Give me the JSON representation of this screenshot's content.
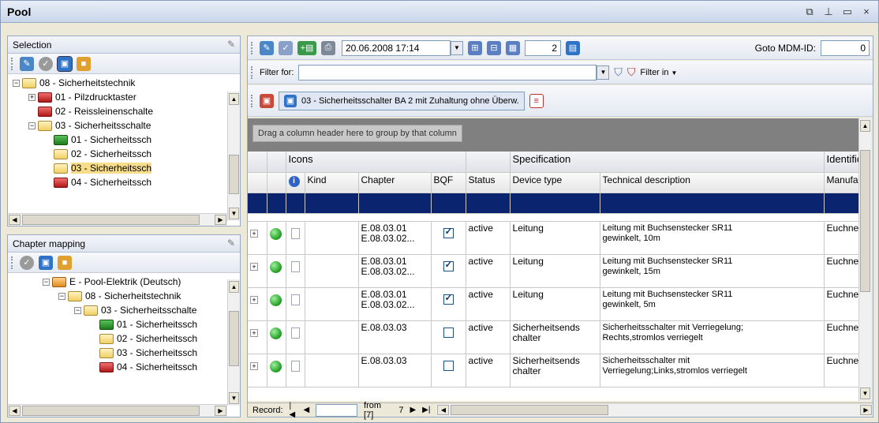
{
  "window": {
    "title": "Pool"
  },
  "title_buttons": [
    "⧉",
    "⊥",
    "▭",
    "×"
  ],
  "selection_panel": {
    "title": "Selection",
    "tree": [
      {
        "label": "08 - Sicherheitstechnik",
        "level": 0,
        "expander": "−",
        "folder": "yellow"
      },
      {
        "label": "01 - Pilzdrucktaster",
        "level": 1,
        "expander": "+",
        "folder": "red"
      },
      {
        "label": "02 - Reissleinenschalte",
        "level": 1,
        "expander": "",
        "folder": "red"
      },
      {
        "label": "03 - Sicherheitsschalte",
        "level": 1,
        "expander": "−",
        "folder": "yellow"
      },
      {
        "label": "01 - Sicherheitssch",
        "level": 2,
        "expander": "",
        "folder": "green"
      },
      {
        "label": "02 - Sicherheitssch",
        "level": 2,
        "expander": "",
        "folder": "yellow"
      },
      {
        "label": "03 - Sicherheitssch",
        "level": 2,
        "expander": "",
        "folder": "yellow",
        "selected": true
      },
      {
        "label": "04 - Sicherheitssch",
        "level": 2,
        "expander": "",
        "folder": "red"
      }
    ]
  },
  "chapter_panel": {
    "title": "Chapter mapping",
    "tree": [
      {
        "label": "E - Pool-Elektrik (Deutsch)",
        "level": 0,
        "expander": "−",
        "folder": "orange"
      },
      {
        "label": "08 - Sicherheitstechnik",
        "level": 1,
        "expander": "−",
        "folder": "yellow"
      },
      {
        "label": "03 - Sicherheitsschalte",
        "level": 2,
        "expander": "−",
        "folder": "yellow"
      },
      {
        "label": "01 - Sicherheitssch",
        "level": 3,
        "expander": "",
        "folder": "green"
      },
      {
        "label": "02 - Sicherheitssch",
        "level": 3,
        "expander": "",
        "folder": "yellow"
      },
      {
        "label": "03 - Sicherheitssch",
        "level": 3,
        "expander": "",
        "folder": "yellow"
      },
      {
        "label": "04 - Sicherheitssch",
        "level": 3,
        "expander": "",
        "folder": "red"
      }
    ]
  },
  "toolbar": {
    "datetime": "20.06.2008 17:14",
    "page_value": "2",
    "goto_label": "Goto MDM-ID:",
    "goto_value": "0"
  },
  "filter": {
    "label": "Filter for:",
    "value": "",
    "filter_in_label": "Filter in"
  },
  "breadcrumb": {
    "label": "03 - Sicherheitsschalter BA 2 mit Zuhaltung ohne Überw."
  },
  "grid": {
    "group_hint": "Drag a column header here to group by that column",
    "bands": [
      "Icons",
      "Specification",
      "Identificatio"
    ],
    "columns": [
      "",
      "Kind",
      "Chapter",
      "BQF",
      "Status",
      "Device type",
      "Technical description",
      "Manufacturer"
    ],
    "rows": [
      {
        "chapter_l1": "E.08.03.01",
        "chapter_l2": "E.08.03.02...",
        "bqf": true,
        "status": "active",
        "device_l1": "Leitung",
        "device_l2": "",
        "desc_l1": "Leitung mit Buchsenstecker SR11",
        "desc_l2": "gewinkelt, 10m",
        "manufacturer": "Euchner"
      },
      {
        "chapter_l1": "E.08.03.01",
        "chapter_l2": "E.08.03.02...",
        "bqf": true,
        "status": "active",
        "device_l1": "Leitung",
        "device_l2": "",
        "desc_l1": "Leitung mit Buchsenstecker SR11",
        "desc_l2": "gewinkelt, 15m",
        "manufacturer": "Euchner"
      },
      {
        "chapter_l1": "E.08.03.01",
        "chapter_l2": "E.08.03.02...",
        "bqf": true,
        "status": "active",
        "device_l1": "Leitung",
        "device_l2": "",
        "desc_l1": "Leitung mit Buchsenstecker SR11",
        "desc_l2": "gewinkelt, 5m",
        "manufacturer": "Euchner"
      },
      {
        "chapter_l1": "E.08.03.03",
        "chapter_l2": "",
        "bqf": false,
        "status": "active",
        "device_l1": "Sicherheitsends",
        "device_l2": "chalter",
        "desc_l1": "Sicherheitsschalter mit Verriegelung;",
        "desc_l2": "Rechts,stromlos verriegelt",
        "manufacturer": "Euchner"
      },
      {
        "chapter_l1": "E.08.03.03",
        "chapter_l2": "",
        "bqf": false,
        "status": "active",
        "device_l1": "Sicherheitsends",
        "device_l2": "chalter",
        "desc_l1": "Sicherheitsschalter mit",
        "desc_l2": "Verriegelung;Links,stromlos verriegelt",
        "manufacturer": "Euchner"
      }
    ]
  },
  "record_nav": {
    "label": "Record:",
    "value": "",
    "from_label": "from [7]",
    "count": "7"
  },
  "colors": {
    "filter_row": "#0a2470",
    "selected_node": "#f7dd8a"
  }
}
